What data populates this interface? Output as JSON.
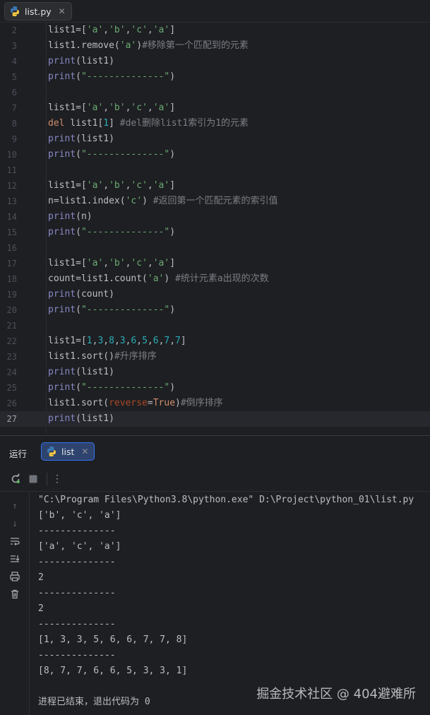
{
  "tab": {
    "label": "list.py",
    "icon": "python-file-icon"
  },
  "editor": {
    "current_line": 27,
    "lines": [
      {
        "n": "2",
        "tokens": [
          [
            "plain",
            "list1=["
          ],
          [
            "str",
            "'a'"
          ],
          [
            "plain",
            ","
          ],
          [
            "str",
            "'b'"
          ],
          [
            "plain",
            ","
          ],
          [
            "str",
            "'c'"
          ],
          [
            "plain",
            ","
          ],
          [
            "str",
            "'a'"
          ],
          [
            "plain",
            "]"
          ]
        ]
      },
      {
        "n": "3",
        "tokens": [
          [
            "plain",
            "list1.remove("
          ],
          [
            "str",
            "'a'"
          ],
          [
            "plain",
            ")"
          ],
          [
            "cmt",
            "#移除第一个匹配到的元素"
          ]
        ]
      },
      {
        "n": "4",
        "tokens": [
          [
            "bi",
            "print"
          ],
          [
            "plain",
            "(list1)"
          ]
        ]
      },
      {
        "n": "5",
        "tokens": [
          [
            "bi",
            "print"
          ],
          [
            "plain",
            "("
          ],
          [
            "str",
            "\"--------------\""
          ],
          [
            "plain",
            ")"
          ]
        ]
      },
      {
        "n": "6",
        "tokens": []
      },
      {
        "n": "7",
        "tokens": [
          [
            "plain",
            "list1=["
          ],
          [
            "str",
            "'a'"
          ],
          [
            "plain",
            ","
          ],
          [
            "str",
            "'b'"
          ],
          [
            "plain",
            ","
          ],
          [
            "str",
            "'c'"
          ],
          [
            "plain",
            ","
          ],
          [
            "str",
            "'a'"
          ],
          [
            "plain",
            "]"
          ]
        ]
      },
      {
        "n": "8",
        "tokens": [
          [
            "kw",
            "del"
          ],
          [
            "plain",
            " list1["
          ],
          [
            "num",
            "1"
          ],
          [
            "plain",
            "] "
          ],
          [
            "cmt",
            "#del删除list1索引为1的元素"
          ]
        ]
      },
      {
        "n": "9",
        "tokens": [
          [
            "bi",
            "print"
          ],
          [
            "plain",
            "(list1)"
          ]
        ]
      },
      {
        "n": "10",
        "tokens": [
          [
            "bi",
            "print"
          ],
          [
            "plain",
            "("
          ],
          [
            "str",
            "\"--------------\""
          ],
          [
            "plain",
            ")"
          ]
        ]
      },
      {
        "n": "11",
        "tokens": []
      },
      {
        "n": "12",
        "tokens": [
          [
            "plain",
            "list1=["
          ],
          [
            "str",
            "'a'"
          ],
          [
            "plain",
            ","
          ],
          [
            "str",
            "'b'"
          ],
          [
            "plain",
            ","
          ],
          [
            "str",
            "'c'"
          ],
          [
            "plain",
            ","
          ],
          [
            "str",
            "'a'"
          ],
          [
            "plain",
            "]"
          ]
        ]
      },
      {
        "n": "13",
        "tokens": [
          [
            "plain",
            "n=list1.index("
          ],
          [
            "str",
            "'c'"
          ],
          [
            "plain",
            ") "
          ],
          [
            "cmt",
            "#返回第一个匹配元素的索引值"
          ]
        ]
      },
      {
        "n": "14",
        "tokens": [
          [
            "bi",
            "print"
          ],
          [
            "plain",
            "(n)"
          ]
        ]
      },
      {
        "n": "15",
        "tokens": [
          [
            "bi",
            "print"
          ],
          [
            "plain",
            "("
          ],
          [
            "str",
            "\"--------------\""
          ],
          [
            "plain",
            ")"
          ]
        ]
      },
      {
        "n": "16",
        "tokens": []
      },
      {
        "n": "17",
        "tokens": [
          [
            "plain",
            "list1=["
          ],
          [
            "str",
            "'a'"
          ],
          [
            "plain",
            ","
          ],
          [
            "str",
            "'b'"
          ],
          [
            "plain",
            ","
          ],
          [
            "str",
            "'c'"
          ],
          [
            "plain",
            ","
          ],
          [
            "str",
            "'a'"
          ],
          [
            "plain",
            "]"
          ]
        ]
      },
      {
        "n": "18",
        "tokens": [
          [
            "plain",
            "count=list1.count("
          ],
          [
            "str",
            "'a'"
          ],
          [
            "plain",
            ") "
          ],
          [
            "cmt",
            "#统计元素a出现的次数"
          ]
        ]
      },
      {
        "n": "19",
        "tokens": [
          [
            "bi",
            "print"
          ],
          [
            "plain",
            "(count)"
          ]
        ]
      },
      {
        "n": "20",
        "tokens": [
          [
            "bi",
            "print"
          ],
          [
            "plain",
            "("
          ],
          [
            "str",
            "\"--------------\""
          ],
          [
            "plain",
            ")"
          ]
        ]
      },
      {
        "n": "21",
        "tokens": []
      },
      {
        "n": "22",
        "tokens": [
          [
            "plain",
            "list1=["
          ],
          [
            "num",
            "1"
          ],
          [
            "plain",
            ","
          ],
          [
            "num",
            "3"
          ],
          [
            "plain",
            ","
          ],
          [
            "num",
            "8"
          ],
          [
            "plain",
            ","
          ],
          [
            "num",
            "3"
          ],
          [
            "plain",
            ","
          ],
          [
            "num",
            "6"
          ],
          [
            "plain",
            ","
          ],
          [
            "num",
            "5"
          ],
          [
            "plain",
            ","
          ],
          [
            "num",
            "6"
          ],
          [
            "plain",
            ","
          ],
          [
            "num",
            "7"
          ],
          [
            "plain",
            ","
          ],
          [
            "num",
            "7"
          ],
          [
            "plain",
            "]"
          ]
        ]
      },
      {
        "n": "23",
        "tokens": [
          [
            "plain",
            "list1.sort()"
          ],
          [
            "cmt",
            "#升序排序"
          ]
        ]
      },
      {
        "n": "24",
        "tokens": [
          [
            "bi",
            "print"
          ],
          [
            "plain",
            "(list1)"
          ]
        ]
      },
      {
        "n": "25",
        "tokens": [
          [
            "bi",
            "print"
          ],
          [
            "plain",
            "("
          ],
          [
            "str",
            "\"--------------\""
          ],
          [
            "plain",
            ")"
          ]
        ]
      },
      {
        "n": "26",
        "tokens": [
          [
            "plain",
            "list1.sort("
          ],
          [
            "param",
            "reverse"
          ],
          [
            "plain",
            "="
          ],
          [
            "kw",
            "True"
          ],
          [
            "plain",
            ")"
          ],
          [
            "cmt",
            "#倒序排序"
          ]
        ]
      },
      {
        "n": "27",
        "tokens": [
          [
            "bi",
            "print"
          ],
          [
            "plain",
            "(list1)"
          ]
        ]
      }
    ]
  },
  "run_panel": {
    "title": "运行",
    "tab_label": "list",
    "console": [
      "\"C:\\Program Files\\Python3.8\\python.exe\" D:\\Project\\python_01\\list.py",
      "['b', 'c', 'a']",
      "--------------",
      "['a', 'c', 'a']",
      "--------------",
      "2",
      "--------------",
      "2",
      "--------------",
      "[1, 3, 3, 5, 6, 6, 7, 7, 8]",
      "--------------",
      "[8, 7, 7, 6, 6, 5, 3, 3, 1]",
      "",
      "进程已结束，退出代码为 0"
    ]
  },
  "watermark": "掘金技术社区 @ 404避难所"
}
